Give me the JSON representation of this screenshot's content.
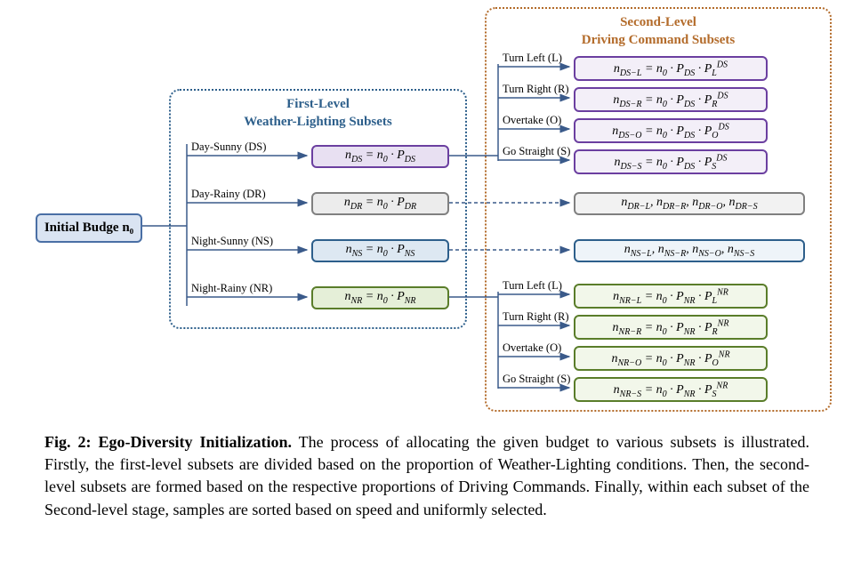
{
  "initial": {
    "label": "Initial Budge n₀"
  },
  "panel1": {
    "title_line1": "First-Level",
    "title_line2": "Weather-Lighting Subsets"
  },
  "panel2": {
    "title_line1": "Second-Level",
    "title_line2": "Driving Command Subsets"
  },
  "level1": {
    "ds": {
      "branch_label": "Day-Sunny (DS)"
    },
    "dr": {
      "branch_label": "Day-Rainy (DR)"
    },
    "ns": {
      "branch_label": "Night-Sunny (NS)"
    },
    "nr": {
      "branch_label": "Night-Rainy (NR)"
    }
  },
  "branches": {
    "tl": "Turn Left (L)",
    "tr": "Turn Right (R)",
    "ov": "Overtake (O)",
    "gs": "Go Straight (S)"
  },
  "caption_title": "Fig. 2: Ego-Diversity Initialization.",
  "caption_body": " The process of allocating the given budget to various subsets is illustrated. Firstly, the first-level subsets are divided based on the proportion of Weather-Lighting conditions. Then, the second-level subsets are formed based on the respective proportions of Driving Commands. Finally, within each subset of the Second-level stage, samples are sorted based on speed and uniformly selected."
}
